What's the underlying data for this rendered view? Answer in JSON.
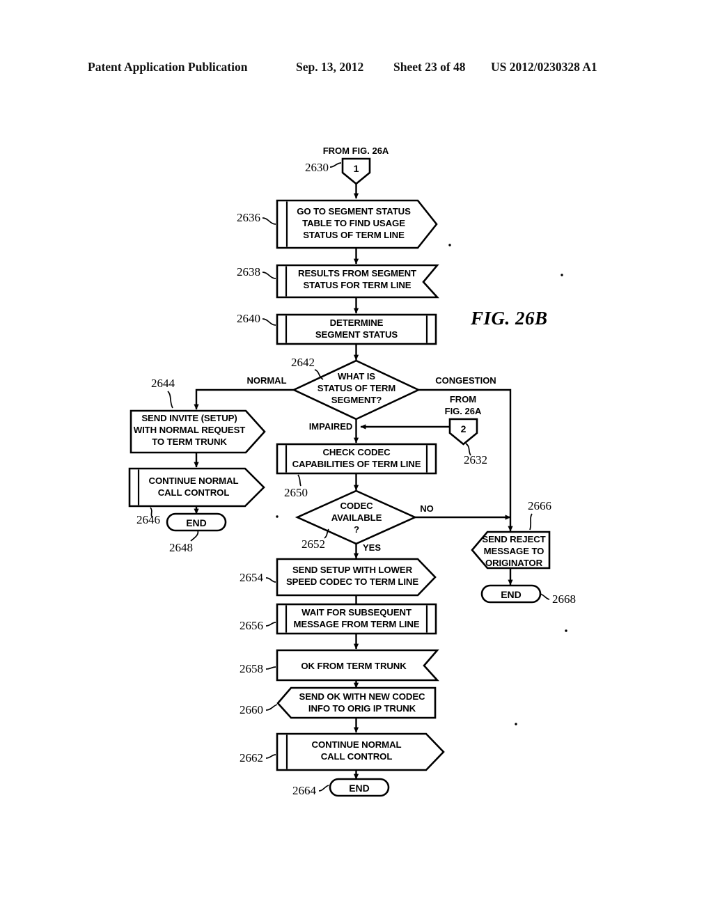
{
  "header": {
    "publication": "Patent Application Publication",
    "date": "Sep. 13, 2012",
    "sheet": "Sheet 23 of 48",
    "number": "US 2012/0230328 A1"
  },
  "figure": {
    "label": "FIG. 26B"
  },
  "connectors": {
    "top": {
      "caption": "FROM FIG. 26A",
      "symbol": "1",
      "ref": "2630"
    },
    "side": {
      "caption_line1": "FROM",
      "caption_line2": "FIG. 26A",
      "symbol": "2",
      "ref": "2632"
    }
  },
  "nodes": [
    {
      "ref": "2636",
      "shape": "predef-send",
      "lines": [
        "GO TO SEGMENT STATUS",
        "TABLE TO FIND USAGE",
        "STATUS OF TERM LINE"
      ]
    },
    {
      "ref": "2638",
      "shape": "receive",
      "lines": [
        "RESULTS FROM SEGMENT",
        "STATUS FOR TERM LINE"
      ]
    },
    {
      "ref": "2640",
      "shape": "predef",
      "lines": [
        "DETERMINE",
        "SEGMENT STATUS"
      ]
    },
    {
      "ref": "2642",
      "shape": "decision",
      "lines": [
        "WHAT IS",
        "STATUS OF TERM",
        "SEGMENT?"
      ]
    },
    {
      "ref": "2644",
      "shape": "send",
      "lines": [
        "SEND INVITE (SETUP)",
        "WITH NORMAL REQUEST",
        "TO TERM TRUNK"
      ]
    },
    {
      "ref": "2646",
      "shape": "predef-send",
      "lines": [
        "CONTINUE NORMAL",
        "CALL CONTROL"
      ]
    },
    {
      "ref": "2648",
      "shape": "terminator",
      "lines": [
        "END"
      ]
    },
    {
      "ref": "2650",
      "shape": "predef",
      "lines": [
        "CHECK CODEC",
        "CAPABILITIES OF TERM LINE"
      ]
    },
    {
      "ref": "2652",
      "shape": "decision",
      "lines": [
        "CODEC",
        "AVAILABLE",
        "?"
      ]
    },
    {
      "ref": "2654",
      "shape": "send",
      "lines": [
        "SEND SETUP WITH LOWER",
        "SPEED CODEC TO TERM LINE"
      ]
    },
    {
      "ref": "2656",
      "shape": "predef",
      "lines": [
        "WAIT FOR SUBSEQUENT",
        "MESSAGE FROM TERM LINE"
      ]
    },
    {
      "ref": "2658",
      "shape": "receive",
      "lines": [
        "OK FROM TERM TRUNK"
      ]
    },
    {
      "ref": "2660",
      "shape": "receive-left",
      "lines": [
        "SEND OK WITH NEW CODEC",
        "INFO TO ORIG IP TRUNK"
      ]
    },
    {
      "ref": "2662",
      "shape": "predef-send",
      "lines": [
        "CONTINUE NORMAL",
        "CALL CONTROL"
      ]
    },
    {
      "ref": "2664",
      "shape": "terminator",
      "lines": [
        "END"
      ]
    },
    {
      "ref": "2666",
      "shape": "receive-left",
      "lines": [
        "SEND REJECT",
        "MESSAGE TO",
        "ORIGINATOR"
      ]
    },
    {
      "ref": "2668",
      "shape": "terminator",
      "lines": [
        "END"
      ]
    }
  ],
  "edge_labels": {
    "normal": "NORMAL",
    "congestion": "CONGESTION",
    "impaired": "IMPAIRED",
    "no": "NO",
    "yes": "YES"
  },
  "colors": {
    "ink": "#000000",
    "paper": "#ffffff"
  }
}
